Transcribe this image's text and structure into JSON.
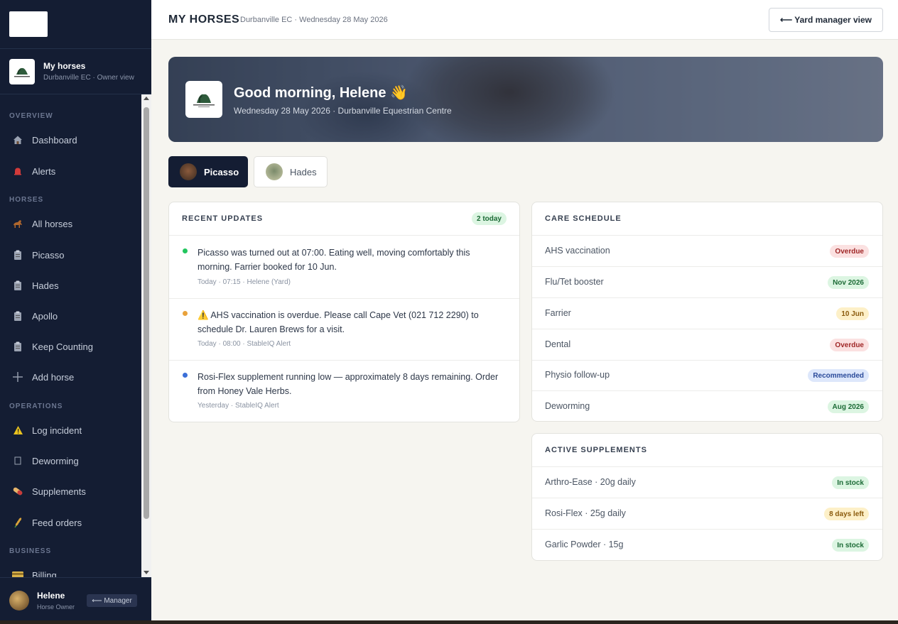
{
  "sidebar": {
    "profile": {
      "name": "My horses",
      "subtitle": "Durbanville EC · Owner view"
    },
    "sections": {
      "overview": "OVERVIEW",
      "horses": "HORSES",
      "operations": "OPERATIONS",
      "business": "BUSINESS"
    },
    "items": [
      {
        "label": "Dashboard",
        "icon": "house-icon"
      },
      {
        "label": "Alerts",
        "icon": "bell-icon"
      },
      {
        "label": "All horses",
        "icon": "horse-icon"
      },
      {
        "label": "Picasso",
        "icon": "clipboard-icon"
      },
      {
        "label": "Hades",
        "icon": "clipboard-icon"
      },
      {
        "label": "Apollo",
        "icon": "clipboard-icon"
      },
      {
        "label": "Keep Counting",
        "icon": "clipboard-icon"
      },
      {
        "label": "Add horse",
        "icon": "plus-icon"
      },
      {
        "label": "Log incident",
        "icon": "warning-icon"
      },
      {
        "label": "Deworming",
        "icon": "square-icon"
      },
      {
        "label": "Supplements",
        "icon": "pill-icon"
      },
      {
        "label": "Feed orders",
        "icon": "wheat-icon"
      },
      {
        "label": "Billing",
        "icon": "card-icon"
      }
    ],
    "user": {
      "name": "Helene",
      "role": "Horse Owner",
      "manager_label": "⟵ Manager"
    }
  },
  "header": {
    "title": "MY HORSES",
    "subtitle": "Durbanville EC · Wednesday 28 May 2026",
    "yard_button": "⟵ Yard manager view"
  },
  "hero": {
    "greeting": "Good morning, Helene 👋",
    "date_line": "Wednesday 28 May 2026 · Durbanville Equestrian Centre"
  },
  "tabs": [
    {
      "label": "Picasso",
      "active": true
    },
    {
      "label": "Hades",
      "active": false
    }
  ],
  "recent_updates": {
    "title": "RECENT UPDATES",
    "badge": "2 today",
    "items": [
      {
        "text": "Picasso was turned out at 07:00. Eating well, moving comfortably this morning. Farrier booked for 10 Jun.",
        "meta": "Today · 07:15 · Helene (Yard)",
        "color": "#22c55e"
      },
      {
        "text": "⚠️ AHS vaccination is overdue. Please call Cape Vet (021 712 2290) to schedule Dr. Lauren Brews for a visit.",
        "meta": "Today · 08:00 · StableIQ Alert",
        "color": "#e9a23b"
      },
      {
        "text": "Rosi-Flex supplement running low — approximately 8 days remaining. Order from Honey Vale Herbs.",
        "meta": "Yesterday · StableIQ Alert",
        "color": "#3b6fd8"
      }
    ]
  },
  "care_schedule": {
    "title": "CARE SCHEDULE",
    "rows": [
      {
        "label": "AHS vaccination",
        "status": "Overdue",
        "tone": "red"
      },
      {
        "label": "Flu/Tet booster",
        "status": "Nov 2026",
        "tone": "green"
      },
      {
        "label": "Farrier",
        "status": "10 Jun",
        "tone": "amber"
      },
      {
        "label": "Dental",
        "status": "Overdue",
        "tone": "red"
      },
      {
        "label": "Physio follow-up",
        "status": "Recommended",
        "tone": "blue"
      },
      {
        "label": "Deworming",
        "status": "Aug 2026",
        "tone": "green"
      }
    ]
  },
  "active_supplements": {
    "title": "ACTIVE SUPPLEMENTS",
    "rows": [
      {
        "label": "Arthro-Ease · 20g daily",
        "status": "In stock",
        "tone": "green"
      },
      {
        "label": "Rosi-Flex · 25g daily",
        "status": "8 days left",
        "tone": "amber"
      },
      {
        "label": "Garlic Powder · 15g",
        "status": "In stock",
        "tone": "green"
      }
    ]
  }
}
